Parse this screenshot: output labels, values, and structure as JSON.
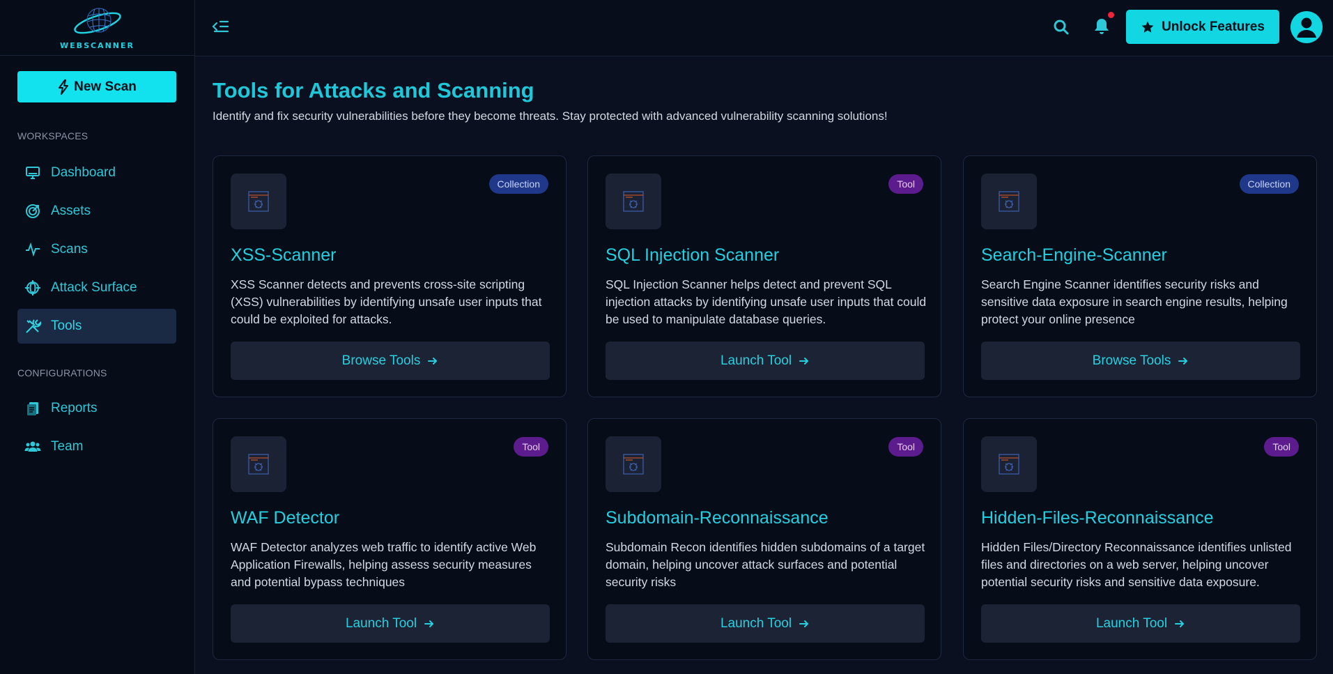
{
  "brand": {
    "name": "WEBSCANNER"
  },
  "sidebar": {
    "new_scan_label": "New Scan",
    "workspaces_label": "WORKSPACES",
    "configurations_label": "CONFIGURATIONS",
    "workspace_items": [
      {
        "label": "Dashboard",
        "icon": "monitor-icon"
      },
      {
        "label": "Assets",
        "icon": "target-icon"
      },
      {
        "label": "Scans",
        "icon": "pulse-icon"
      },
      {
        "label": "Attack Surface",
        "icon": "crosshair-globe-icon"
      },
      {
        "label": "Tools",
        "icon": "tools-icon",
        "active": true
      }
    ],
    "config_items": [
      {
        "label": "Reports",
        "icon": "reports-icon"
      },
      {
        "label": "Team",
        "icon": "team-icon"
      }
    ]
  },
  "topbar": {
    "unlock_label": "Unlock Features",
    "has_notification": true
  },
  "main": {
    "title": "Tools for Attacks and Scanning",
    "subtitle": "Identify and fix security vulnerabilities before they become threats. Stay protected with advanced vulnerability scanning solutions!",
    "cards": [
      {
        "badge": "Collection",
        "title": "XSS-Scanner",
        "description": "XSS Scanner detects and prevents cross-site scripting (XSS) vulnerabilities by identifying unsafe user inputs that could be exploited for attacks.",
        "button": "Browse Tools"
      },
      {
        "badge": "Tool",
        "title": "SQL Injection Scanner",
        "description": "SQL Injection Scanner helps detect and prevent SQL injection attacks by identifying unsafe user inputs that could be used to manipulate database queries.",
        "button": "Launch Tool"
      },
      {
        "badge": "Collection",
        "title": "Search-Engine-Scanner",
        "description": "Search Engine Scanner identifies security risks and sensitive data exposure in search engine results, helping protect your online presence",
        "button": "Browse Tools"
      },
      {
        "badge": "Tool",
        "title": "WAF Detector",
        "description": "WAF Detector analyzes web traffic to identify active Web Application Firewalls, helping assess security measures and potential bypass techniques",
        "button": "Launch Tool"
      },
      {
        "badge": "Tool",
        "title": "Subdomain-Reconnaissance",
        "description": "Subdomain Recon identifies hidden subdomains of a target domain, helping uncover attack surfaces and potential security risks",
        "button": "Launch Tool"
      },
      {
        "badge": "Tool",
        "title": "Hidden-Files-Reconnaissance",
        "description": "Hidden Files/Directory Reconnaissance identifies unlisted files and directories on a web server, helping uncover potential security risks and sensitive data exposure.",
        "button": "Launch Tool"
      }
    ]
  },
  "colors": {
    "accent": "#12e2ee",
    "background": "#0b1020",
    "badge_collection": "#20388a",
    "badge_tool": "#5c1c8e",
    "notification": "#f0243a"
  }
}
